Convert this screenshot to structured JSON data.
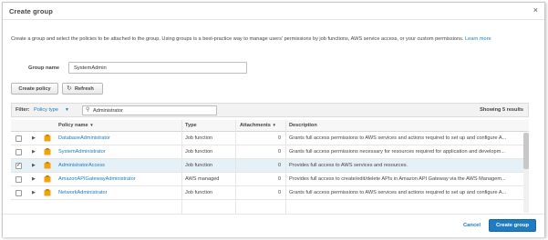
{
  "dialog": {
    "title": "Create group",
    "close_glyph": "×"
  },
  "intro": {
    "text": "Create a group and select the policies to be attached to the group. Using groups is a best-practice way to manage users' permissions by job functions, AWS service access, or your custom permissions.",
    "link": "Learn more"
  },
  "group_name": {
    "label": "Group name",
    "value": "SystemAdmin"
  },
  "toolbar": {
    "create_policy": "Create policy",
    "refresh": "Refresh",
    "refresh_icon": "refresh-icon"
  },
  "filter": {
    "label": "Filter:",
    "type": "Policy type",
    "search_value": "Administrator",
    "result_count": "Showing 5 results"
  },
  "table": {
    "headers": {
      "policy_name": "Policy name",
      "sort_glyph": "▼",
      "type": "Type",
      "attachments": "Attachments",
      "attachments_sort": "▼",
      "description": "Description"
    },
    "rows": [
      {
        "name": "DatabaseAdministrator",
        "type": "Job function",
        "attachments": "0",
        "description": "Grants full access permissions to AWS services and actions required to set up and configure A...",
        "checked": false,
        "check_glyph": ""
      },
      {
        "name": "SystemAdministrator",
        "type": "Job function",
        "attachments": "0",
        "description": "Grants full access permissions necessary for resources required for application and developm...",
        "checked": false,
        "check_glyph": ""
      },
      {
        "name": "AdministratorAccess",
        "type": "Job function",
        "attachments": "0",
        "description": "Provides full access to AWS services and resources.",
        "checked": true,
        "check_glyph": "✓"
      },
      {
        "name": "AmazonAPIGatewayAdministrator",
        "type": "AWS managed",
        "attachments": "0",
        "description": "Provides full access to create/edit/delete APIs in Amazon API Gateway via the AWS Managem...",
        "checked": false,
        "check_glyph": ""
      },
      {
        "name": "NetworkAdministrator",
        "type": "Job function",
        "attachments": "0",
        "description": "Grants full access permissions to AWS services and actions required to set up and configure A...",
        "checked": false,
        "check_glyph": ""
      }
    ]
  },
  "footer": {
    "cancel": "Cancel",
    "create_group": "Create group"
  },
  "colors": {
    "link": "#1a7bbf",
    "primary_button": "#1f7cc2",
    "policy_icon": "#f0a30a",
    "selected_row": "#e6f0f7"
  }
}
